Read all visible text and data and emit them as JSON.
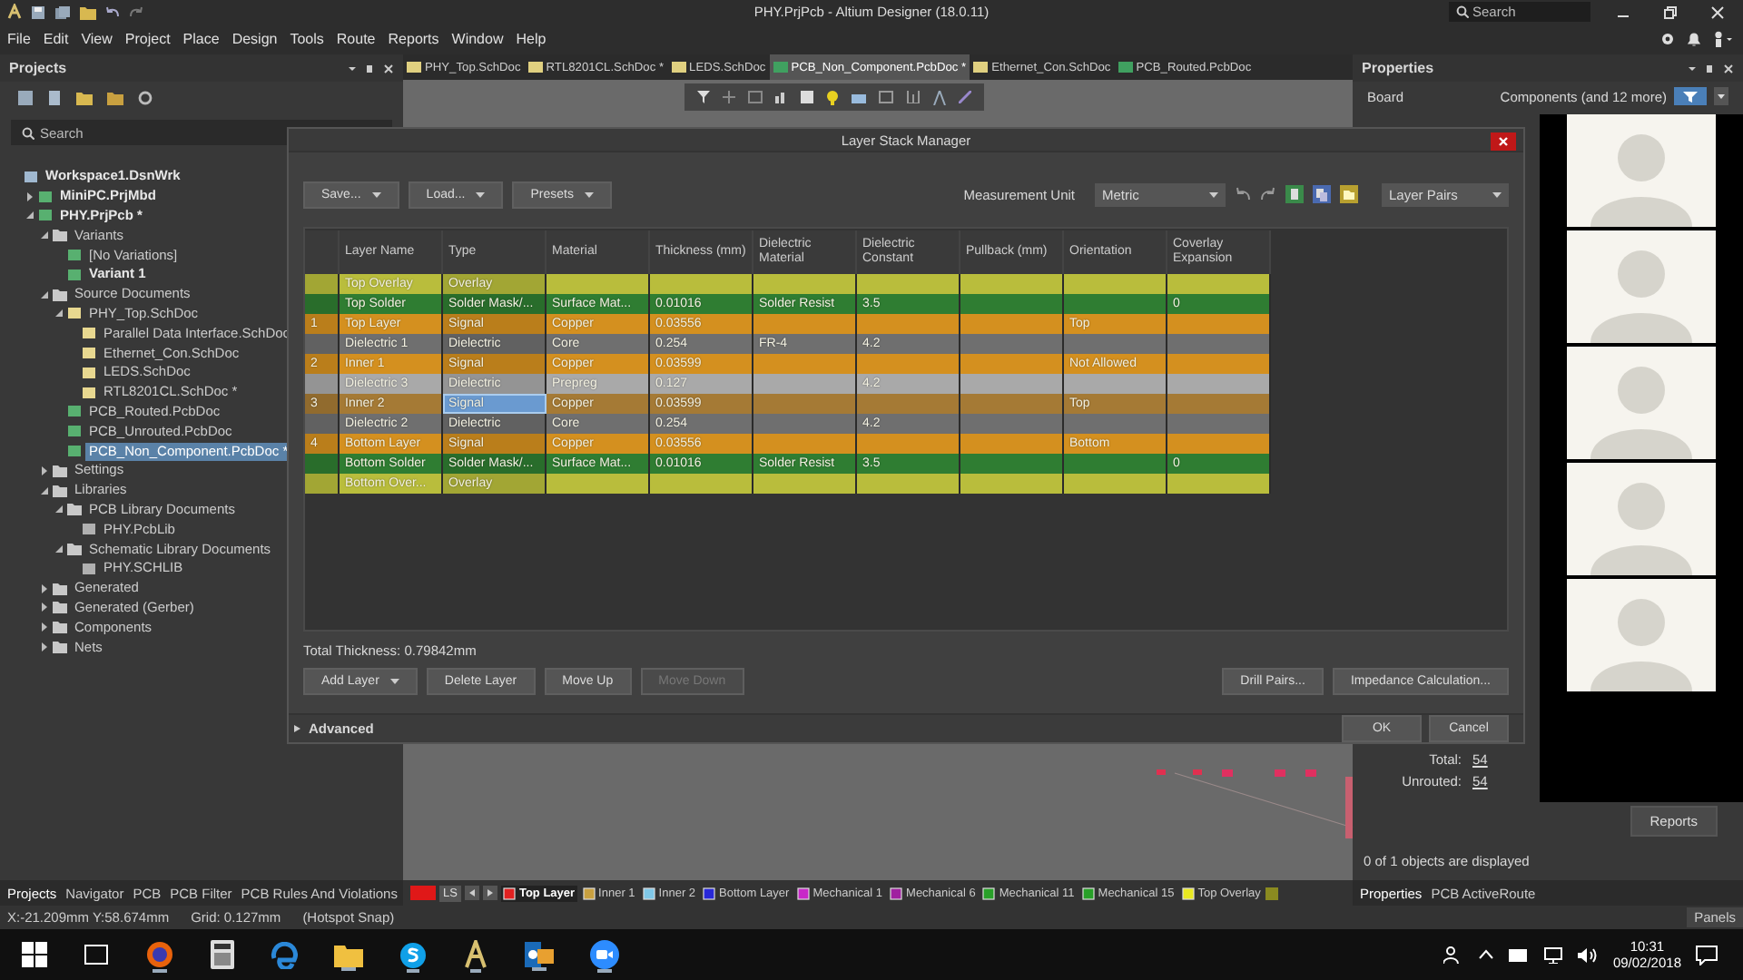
{
  "window": {
    "title": "PHY.PrjPcb - Altium Designer (18.0.11)",
    "search_placeholder": "Search"
  },
  "menu": [
    "File",
    "Edit",
    "View",
    "Project",
    "Place",
    "Design",
    "Tools",
    "Route",
    "Reports",
    "Window",
    "Help"
  ],
  "projects": {
    "title": "Projects",
    "search_placeholder": "Search",
    "tree": [
      {
        "label": "Workspace1.DsnWrk",
        "kind": "workspace",
        "bold": true,
        "selected": false,
        "children": [
          {
            "label": "MiniPC.PrjMbd",
            "kind": "project",
            "bold": true,
            "expanded": false,
            "selected": false
          },
          {
            "label": "PHY.PrjPcb *",
            "kind": "project",
            "bold": true,
            "expanded": true,
            "selected": false,
            "children": [
              {
                "label": "Variants",
                "kind": "folder",
                "expanded": true,
                "selected": false,
                "children": [
                  {
                    "label": "[No Variations]",
                    "kind": "variant",
                    "selected": false
                  },
                  {
                    "label": "Variant 1",
                    "kind": "variant",
                    "bold": true,
                    "selected": false
                  }
                ]
              },
              {
                "label": "Source Documents",
                "kind": "folder",
                "expanded": true,
                "selected": false,
                "children": [
                  {
                    "label": "PHY_Top.SchDoc",
                    "kind": "sch",
                    "expanded": true,
                    "selected": false,
                    "children": [
                      {
                        "label": "Parallel Data Interface.SchDoc",
                        "kind": "sch",
                        "selected": false
                      },
                      {
                        "label": "Ethernet_Con.SchDoc",
                        "kind": "sch",
                        "selected": false
                      },
                      {
                        "label": "LEDS.SchDoc",
                        "kind": "sch",
                        "selected": false
                      },
                      {
                        "label": "RTL8201CL.SchDoc *",
                        "kind": "sch",
                        "selected": false
                      }
                    ]
                  },
                  {
                    "label": "PCB_Routed.PcbDoc",
                    "kind": "pcb",
                    "selected": false
                  },
                  {
                    "label": "PCB_Unrouted.PcbDoc",
                    "kind": "pcb",
                    "selected": false
                  },
                  {
                    "label": "PCB_Non_Component.PcbDoc *",
                    "kind": "pcb",
                    "selected": true
                  }
                ]
              },
              {
                "label": "Settings",
                "kind": "folder",
                "expanded": false,
                "selected": false
              },
              {
                "label": "Libraries",
                "kind": "folder",
                "expanded": true,
                "selected": false,
                "children": [
                  {
                    "label": "PCB Library Documents",
                    "kind": "folder",
                    "expanded": true,
                    "selected": false,
                    "children": [
                      {
                        "label": "PHY.PcbLib",
                        "kind": "lib",
                        "selected": false
                      }
                    ]
                  },
                  {
                    "label": "Schematic Library Documents",
                    "kind": "folder",
                    "expanded": true,
                    "selected": false,
                    "children": [
                      {
                        "label": "PHY.SCHLIB",
                        "kind": "lib",
                        "selected": false
                      }
                    ]
                  }
                ]
              },
              {
                "label": "Generated",
                "kind": "folder",
                "expanded": false,
                "selected": false
              },
              {
                "label": "Generated (Gerber)",
                "kind": "folder",
                "expanded": false,
                "selected": false
              },
              {
                "label": "Components",
                "kind": "folder",
                "expanded": false,
                "selected": false
              },
              {
                "label": "Nets",
                "kind": "folder",
                "expanded": false,
                "selected": false
              }
            ]
          }
        ]
      }
    ]
  },
  "doc_tabs": [
    {
      "label": "PHY_Top.SchDoc",
      "kind": "sch",
      "selected": false
    },
    {
      "label": "RTL8201CL.SchDoc *",
      "kind": "sch",
      "selected": false
    },
    {
      "label": "LEDS.SchDoc",
      "kind": "sch",
      "selected": false
    },
    {
      "label": "PCB_Non_Component.PcbDoc *",
      "kind": "pcb",
      "selected": true
    },
    {
      "label": "Ethernet_Con.SchDoc",
      "kind": "sch",
      "selected": false
    },
    {
      "label": "PCB_Routed.PcbDoc",
      "kind": "pcb",
      "selected": false
    }
  ],
  "properties": {
    "title": "Properties",
    "section": "Board",
    "filter": "Components (and 12 more)",
    "total_label": "Total:",
    "total": "54",
    "unrouted_label": "Unrouted:",
    "unrouted": "54",
    "reports_button": "Reports",
    "footer": "0 of 1 objects are displayed"
  },
  "dialog": {
    "title": "Layer Stack Manager",
    "toolbar_buttons": [
      "Save...",
      "Load...",
      "Presets"
    ],
    "measurement_label": "Measurement Unit",
    "measurement_unit": "Metric",
    "layer_pairs": "Layer Pairs",
    "columns": [
      "Layer Name",
      "Type",
      "Material",
      "Thickness (mm)",
      "Dielectric Material",
      "Dielectric Constant",
      "Pullback (mm)",
      "Orientation",
      "Coverlay Expansion"
    ],
    "rows": [
      {
        "layer_name": "Top Overlay",
        "type": "Overlay",
        "color": "#b9bd3c",
        "selected": false
      },
      {
        "layer_name": "Top Solder",
        "type": "Solder Mask/...",
        "material": "Surface Mat...",
        "thickness": "0.01016",
        "dielectric_material": "Solder Resist",
        "dielectric_constant": "3.5",
        "coverlay_expansion": "0",
        "color": "#2f7d32",
        "selected": false
      },
      {
        "number": "1",
        "layer_name": "Top Layer",
        "type": "Signal",
        "material": "Copper",
        "thickness": "0.03556",
        "orientation": "Top",
        "color": "#d4901f",
        "selected": false
      },
      {
        "layer_name": "Dielectric 1",
        "type": "Dielectric",
        "material": "Core",
        "thickness": "0.254",
        "dielectric_material": "FR-4",
        "dielectric_constant": "4.2",
        "color": "#6f6f6f",
        "selected": false
      },
      {
        "number": "2",
        "layer_name": "Inner 1",
        "type": "Signal",
        "material": "Copper",
        "thickness": "0.03599",
        "orientation": "Not Allowed",
        "color": "#d4901f",
        "selected": false
      },
      {
        "layer_name": "Dielectric 3",
        "type": "Dielectric",
        "material": "Prepreg",
        "thickness": "0.127",
        "dielectric_constant": "4.2",
        "color": "#a9a9a9",
        "selected": false
      },
      {
        "number": "3",
        "layer_name": "Inner 2",
        "type": "Signal",
        "material": "Copper",
        "thickness": "0.03599",
        "orientation": "Top",
        "color": "#a57a35",
        "selected": true
      },
      {
        "layer_name": "Dielectric 2",
        "type": "Dielectric",
        "material": "Core",
        "thickness": "0.254",
        "dielectric_constant": "4.2",
        "color": "#6f6f6f",
        "selected": false
      },
      {
        "number": "4",
        "layer_name": "Bottom Layer",
        "type": "Signal",
        "material": "Copper",
        "thickness": "0.03556",
        "orientation": "Bottom",
        "color": "#d4901f",
        "selected": false
      },
      {
        "layer_name": "Bottom Solder",
        "type": "Solder Mask/...",
        "material": "Surface Mat...",
        "thickness": "0.01016",
        "dielectric_material": "Solder Resist",
        "dielectric_constant": "3.5",
        "coverlay_expansion": "0",
        "color": "#2f7d32",
        "selected": false
      },
      {
        "layer_name": "Bottom Over...",
        "type": "Overlay",
        "color": "#b9bd3c",
        "selected": false
      }
    ],
    "total_thickness": "Total Thickness: 0.79842mm",
    "buttons_left": [
      {
        "label": "Add Layer",
        "kind": "split",
        "disabled": false
      },
      {
        "label": "Delete Layer",
        "kind": "plain",
        "disabled": false
      },
      {
        "label": "Move Up",
        "kind": "plain",
        "disabled": false
      },
      {
        "label": "Move Down",
        "kind": "plain",
        "disabled": true
      }
    ],
    "buttons_right": [
      "Drill Pairs...",
      "Impedance Calculation..."
    ],
    "advanced": {
      "label": "Advanced",
      "expanded": false
    },
    "ok": "OK",
    "cancel": "Cancel"
  },
  "left_tabs": [
    {
      "label": "Projects",
      "selected": true
    },
    {
      "label": "Navigator",
      "selected": false
    },
    {
      "label": "PCB",
      "selected": false
    },
    {
      "label": "PCB Filter",
      "selected": false
    },
    {
      "label": "PCB Rules And Violations",
      "selected": false
    }
  ],
  "layer_tabs": {
    "ls": "LS",
    "items": [
      {
        "label": "Top Layer",
        "color": "#e02020",
        "selected": true
      },
      {
        "label": "Inner 1",
        "color": "#c8a040",
        "selected": false
      },
      {
        "label": "Inner 2",
        "color": "#80c8e8",
        "selected": false
      },
      {
        "label": "Bottom Layer",
        "color": "#2828d8",
        "selected": false
      },
      {
        "label": "Mechanical 1",
        "color": "#c828c8",
        "selected": false
      },
      {
        "label": "Mechanical 6",
        "color": "#a020a0",
        "selected": false
      },
      {
        "label": "Mechanical 11",
        "color": "#28a028",
        "selected": false
      },
      {
        "label": "Mechanical 15",
        "color": "#28a028",
        "selected": false
      },
      {
        "label": "Top Overlay",
        "color": "#e8e820",
        "selected": false
      }
    ]
  },
  "right_tabs": [
    {
      "label": "Properties",
      "selected": true
    },
    {
      "label": "PCB ActiveRoute",
      "selected": false
    }
  ],
  "status_bar": {
    "coords": "X:-21.209mm Y:58.674mm",
    "grid": "Grid: 0.127mm",
    "snap": "(Hotspot Snap)",
    "panels": "Panels"
  },
  "video_tiles": [
    {
      "kind": "avatar"
    },
    {
      "kind": "avatar"
    },
    {
      "kind": "avatar"
    },
    {
      "kind": "avatar"
    },
    {
      "kind": "avatar"
    }
  ],
  "taskbar": {
    "time": "10:31",
    "date": "09/02/2018"
  }
}
